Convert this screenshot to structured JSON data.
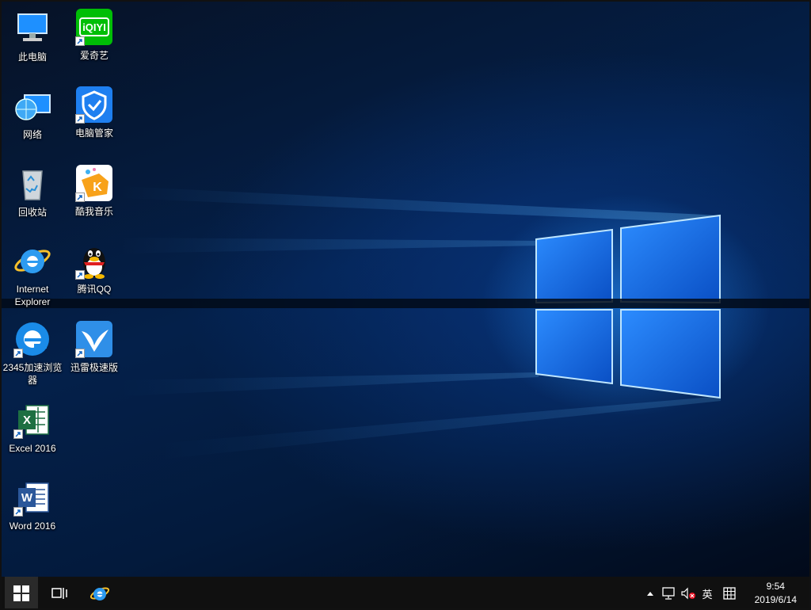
{
  "desktop_icons": {
    "this_pc": "此电脑",
    "network": "网络",
    "recycle_bin": "回收站",
    "internet_explorer": "Internet Explorer",
    "browser_2345": "2345加速浏览器",
    "excel": "Excel 2016",
    "word": "Word 2016",
    "iqiyi": "爱奇艺",
    "pc_manager": "电脑管家",
    "kuwo": "酷我音乐",
    "qq": "腾讯QQ",
    "xunlei": "迅雷极速版"
  },
  "icon_logos": {
    "iqiyi": "iQIYI",
    "excel": "X",
    "word": "W",
    "kuwo": "K"
  },
  "taskbar": {
    "start_icon": "windows-logo",
    "task_view_icon": "task-view",
    "pinned": [
      "internet-explorer"
    ]
  },
  "tray": {
    "input_language": "英",
    "time": "9:54",
    "date": "2019/6/14"
  },
  "colors": {
    "taskbar": "#101010",
    "accent": "#1e90ff",
    "iqiyi_green": "#00be06",
    "excel_green": "#1d6f42",
    "word_blue": "#2b579a"
  }
}
